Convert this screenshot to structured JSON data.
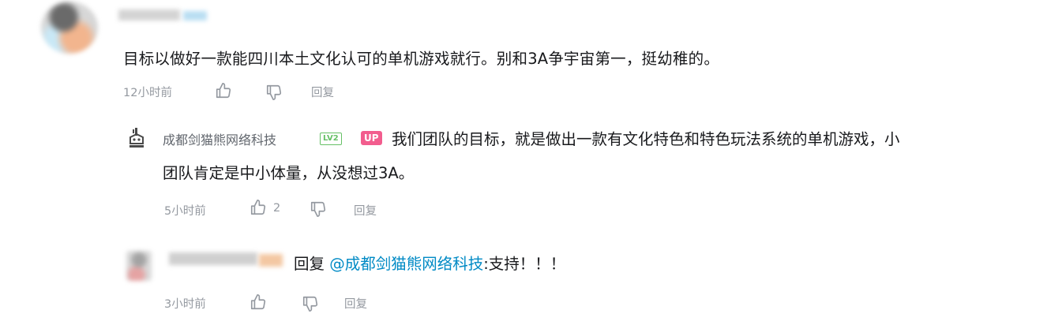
{
  "comment": {
    "text": "目标以做好一款能四川本土文化认可的单机游戏就行。别和3A争宇宙第一，挺幼稚的。",
    "time": "12小时前",
    "reply_label": "回复"
  },
  "reply1": {
    "author": "成都剑猫熊网络科技",
    "level_badge": "LV2",
    "up_badge": "UP",
    "text_line1": "我们团队的目标，就是做出一款有文化特色和特色玩法系统的单机游戏，小",
    "text_line2": "团队肯定是中小体量，从没想过3A。",
    "time": "5小时前",
    "likes": "2",
    "reply_label": "回复"
  },
  "reply2": {
    "prefix": "回复 ",
    "mention": "@成都剑猫熊网络科技",
    "text": ":支持！！！",
    "time": "3小时前",
    "reply_label": "回复"
  }
}
